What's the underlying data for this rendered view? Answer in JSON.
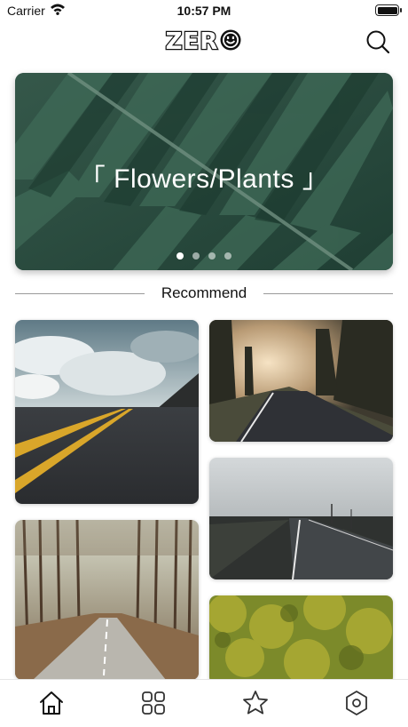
{
  "status_bar": {
    "carrier": "Carrier",
    "time": "10:57 PM"
  },
  "header": {
    "logo_text": "ZER",
    "logo_icon": "smiley-o-icon",
    "search_icon": "search-icon"
  },
  "banner": {
    "title": "「 Flowers/Plants 」",
    "page_count": 4,
    "active_page": 1
  },
  "recommend": {
    "title": "Recommend",
    "cards": [
      {
        "name": "photo-asphalt-road-clouds"
      },
      {
        "name": "photo-forest-road-sunlight"
      },
      {
        "name": "photo-forest-path"
      },
      {
        "name": "photo-wet-road-field"
      },
      {
        "name": "photo-yellow-foliage"
      }
    ]
  },
  "tabbar": {
    "items": [
      {
        "icon": "home-icon",
        "active": true
      },
      {
        "icon": "grid-icon",
        "active": false
      },
      {
        "icon": "star-icon",
        "active": false
      },
      {
        "icon": "hexagon-settings-icon",
        "active": false
      }
    ]
  },
  "colors": {
    "accent": "#111111",
    "banner_green": "#2a4d3e",
    "divider": "#9a9a9a"
  }
}
